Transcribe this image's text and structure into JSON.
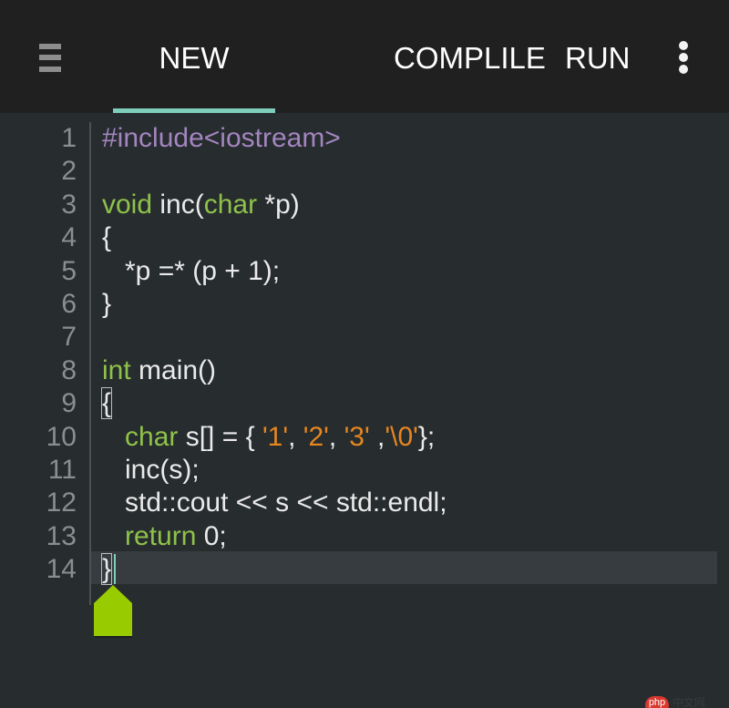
{
  "toolbar": {
    "menu_icon": "hamburger-menu-icon",
    "tab_label": "NEW",
    "compile_label": "COMPLILE",
    "run_label": "RUN",
    "more_icon": "vertical-ellipsis-icon",
    "accent_color": "#7fcdbb"
  },
  "editor": {
    "lines": [
      {
        "n": "1",
        "tokens": [
          {
            "t": "#include<iostream>",
            "c": "pre"
          }
        ]
      },
      {
        "n": "2",
        "tokens": []
      },
      {
        "n": "3",
        "tokens": [
          {
            "t": "void",
            "c": "kw"
          },
          {
            "t": " inc(",
            "c": "txt"
          },
          {
            "t": "char",
            "c": "kw"
          },
          {
            "t": " *p)",
            "c": "txt"
          }
        ]
      },
      {
        "n": "4",
        "tokens": [
          {
            "t": "{",
            "c": "txt"
          }
        ]
      },
      {
        "n": "5",
        "tokens": [
          {
            "t": "   *p =* (p + 1);",
            "c": "txt"
          }
        ]
      },
      {
        "n": "6",
        "tokens": [
          {
            "t": "}",
            "c": "txt"
          }
        ]
      },
      {
        "n": "7",
        "tokens": []
      },
      {
        "n": "8",
        "tokens": [
          {
            "t": "int",
            "c": "kw"
          },
          {
            "t": " main()",
            "c": "txt"
          }
        ]
      },
      {
        "n": "9",
        "tokens": [
          {
            "t": "{",
            "c": "txt",
            "match": true
          }
        ]
      },
      {
        "n": "10",
        "tokens": [
          {
            "t": "   ",
            "c": "txt"
          },
          {
            "t": "char",
            "c": "kw"
          },
          {
            "t": " s[] = { ",
            "c": "txt"
          },
          {
            "t": "'1'",
            "c": "str"
          },
          {
            "t": ", ",
            "c": "txt"
          },
          {
            "t": "'2'",
            "c": "str"
          },
          {
            "t": ", ",
            "c": "txt"
          },
          {
            "t": "'3'",
            "c": "str"
          },
          {
            "t": " ,",
            "c": "txt"
          },
          {
            "t": "'\\0'",
            "c": "str"
          },
          {
            "t": "};",
            "c": "txt"
          }
        ]
      },
      {
        "n": "11",
        "tokens": [
          {
            "t": "   inc(s);",
            "c": "txt"
          }
        ]
      },
      {
        "n": "12",
        "tokens": [
          {
            "t": "   std::cout << s << std::endl;",
            "c": "txt"
          }
        ]
      },
      {
        "n": "13",
        "tokens": [
          {
            "t": "   ",
            "c": "txt"
          },
          {
            "t": "return",
            "c": "kw"
          },
          {
            "t": " 0;",
            "c": "txt"
          }
        ]
      },
      {
        "n": "14",
        "tokens": [
          {
            "t": "}",
            "c": "txt",
            "match": true
          }
        ]
      }
    ],
    "colors": {
      "preprocessor": "#a385bf",
      "keyword": "#8fc24a",
      "string": "#e5861f",
      "text": "#eaeaea",
      "line_number": "#8a8e90",
      "cursor_handle": "#99cc00"
    }
  },
  "watermark": {
    "badge": "php",
    "text": "中文网"
  }
}
